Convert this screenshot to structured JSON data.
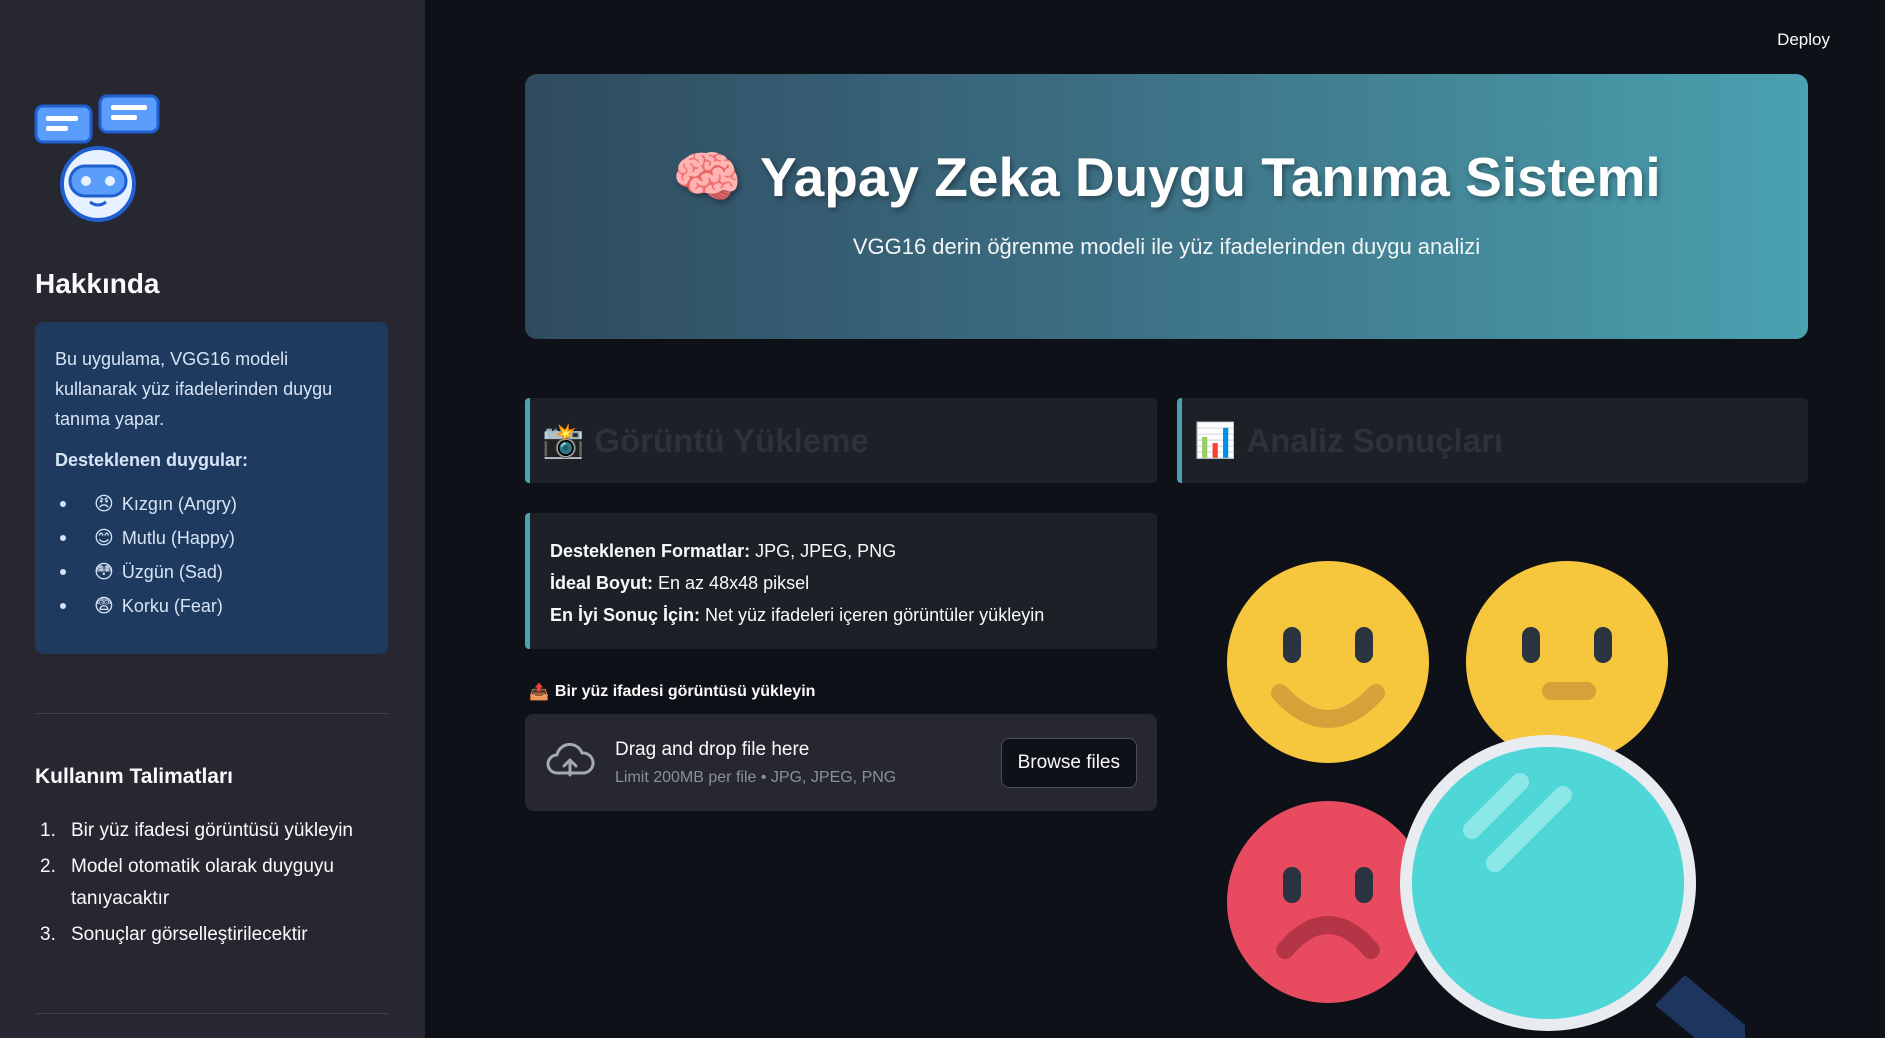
{
  "header": {
    "deploy_label": "Deploy"
  },
  "sidebar": {
    "about_title": "Hakkında",
    "about_text": "Bu uygulama, VGG16 modeli kullanarak yüz ifadelerinden duygu tanıma yapar.",
    "supported_title": "Desteklenen duygular:",
    "emotions": [
      {
        "emoji": "😠",
        "label": "Kızgın (Angry)"
      },
      {
        "emoji": "😊",
        "label": "Mutlu (Happy)"
      },
      {
        "emoji": "😳",
        "label": "Üzgün (Sad)"
      },
      {
        "emoji": "😨",
        "label": "Korku (Fear)"
      }
    ],
    "usage_title": "Kullanım Talimatları",
    "usage_steps": [
      {
        "num": "1.",
        "text": "Bir yüz ifadesi görüntüsü yükleyin"
      },
      {
        "num": "2.",
        "text": "Model otomatik olarak duyguyu tanıyacaktır"
      },
      {
        "num": "3.",
        "text": "Sonuçlar görselleştirilecektir"
      }
    ]
  },
  "hero": {
    "icon": "🧠",
    "title": "Yapay Zeka Duygu Tanıma Sistemi",
    "subtitle": "VGG16 derin öğrenme modeli ile yüz ifadelerinden duygu analizi"
  },
  "upload_section": {
    "icon": "📸",
    "title": "Görüntü Yükleme",
    "info": {
      "formats_label": "Desteklenen Formatlar:",
      "formats_value": "JPG, JPEG, PNG",
      "size_label": "İdeal Boyut:",
      "size_value": "En az 48x48 piksel",
      "best_label": "En İyi Sonuç İçin:",
      "best_value": "Net yüz ifadeleri içeren görüntüler yükleyin"
    },
    "uploader_icon": "📤",
    "uploader_label": "Bir yüz ifadesi görüntüsü yükleyin",
    "dropzone_text": "Drag and drop file here",
    "dropzone_limit": "Limit 200MB per file • JPG, JPEG, PNG",
    "browse_label": "Browse files"
  },
  "results_section": {
    "icon": "📊",
    "title": "Analiz Sonuçları"
  },
  "colors": {
    "background": "#0e1117",
    "sidebar": "#262730",
    "accent": "#4aa1af",
    "about_box": "#1e3a5f"
  }
}
